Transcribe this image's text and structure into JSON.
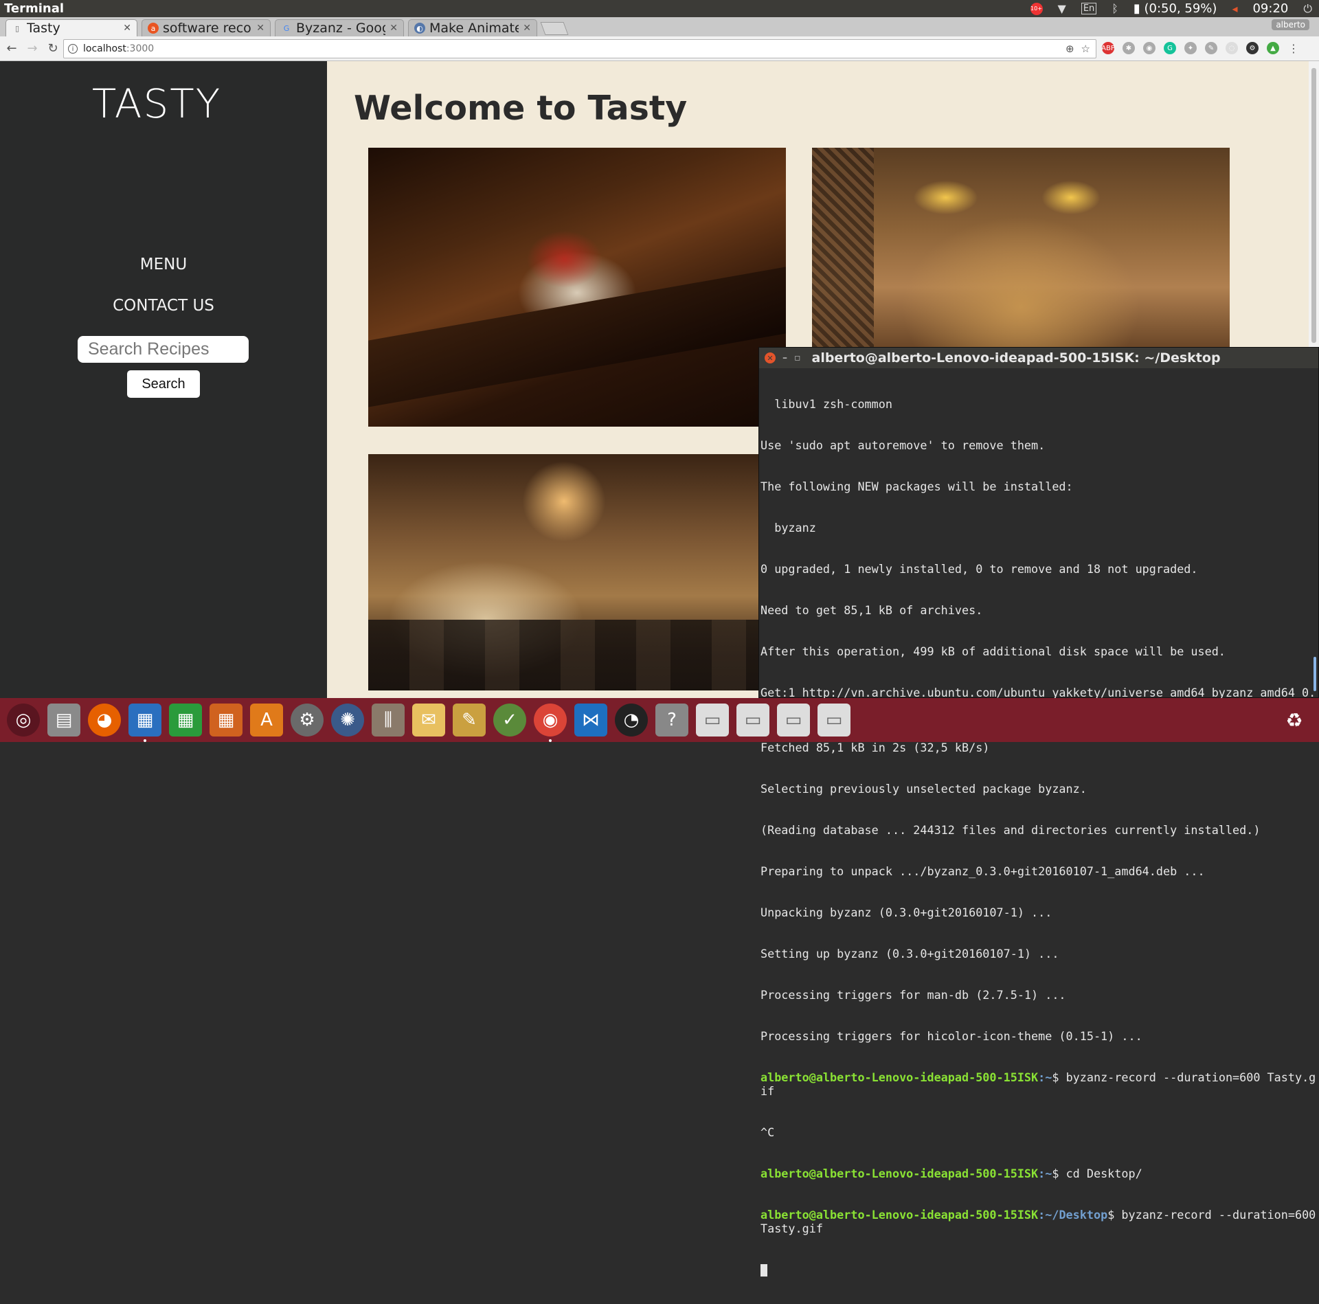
{
  "top_panel": {
    "title": "Terminal",
    "notification_badge": "10+",
    "battery": "(0:50, 59%)",
    "keyboard_layout": "En",
    "clock": "09:20"
  },
  "browser": {
    "tabs": [
      {
        "label": "Tasty",
        "active": true
      },
      {
        "label": "software reco",
        "active": false
      },
      {
        "label": "Byzanz - Goog",
        "active": false
      },
      {
        "label": "Make Animate",
        "active": false
      }
    ],
    "profile": "alberto",
    "url_host": "localhost",
    "url_port": ":3000"
  },
  "page": {
    "brand": "TASTY",
    "nav": {
      "menu": "MENU",
      "contact": "CONTACT US"
    },
    "search": {
      "placeholder": "Search Recipes",
      "button": "Search"
    },
    "title": "Welcome to Tasty"
  },
  "terminal": {
    "title": "alberto@alberto-Lenovo-ideapad-500-15ISK: ~/Desktop",
    "lines": [
      {
        "text": "  libuv1 zsh-common"
      },
      {
        "text": "Use 'sudo apt autoremove' to remove them."
      },
      {
        "text": "The following NEW packages will be installed:"
      },
      {
        "text": "  byzanz"
      },
      {
        "text": "0 upgraded, 1 newly installed, 0 to remove and 18 not upgraded."
      },
      {
        "text": "Need to get 85,1 kB of archives."
      },
      {
        "text": "After this operation, 499 kB of additional disk space will be used."
      },
      {
        "text": "Get:1 http://vn.archive.ubuntu.com/ubuntu yakkety/universe amd64 byzanz amd64 0.3.0+git20160107-1 [85,1 kB]"
      },
      {
        "text": "Fetched 85,1 kB in 2s (32,5 kB/s)"
      },
      {
        "text": "Selecting previously unselected package byzanz."
      },
      {
        "text": "(Reading database ... 244312 files and directories currently installed.)"
      },
      {
        "text": "Preparing to unpack .../byzanz_0.3.0+git20160107-1_amd64.deb ..."
      },
      {
        "text": "Unpacking byzanz (0.3.0+git20160107-1) ..."
      },
      {
        "text": "Setting up byzanz (0.3.0+git20160107-1) ..."
      },
      {
        "text": "Processing triggers for man-db (2.7.5-1) ..."
      },
      {
        "text": "Processing triggers for hicolor-icon-theme (0.15-1) ..."
      }
    ],
    "prompt1": {
      "user": "alberto@alberto-Lenovo-ideapad-500-15ISK",
      "path": ":~",
      "cmd": "$ byzanz-record --duration=600 Tasty.gif"
    },
    "interrupt": "^C",
    "prompt2": {
      "user": "alberto@alberto-Lenovo-ideapad-500-15ISK",
      "path": ":~",
      "cmd": "$ cd Desktop/"
    },
    "prompt3": {
      "user": "alberto@alberto-Lenovo-ideapad-500-15ISK",
      "path": ":~/Desktop",
      "cmd": "$ byzanz-record --duration=600 Tasty.gif"
    }
  },
  "launcher": {
    "items": [
      "ubuntu-icon",
      "files-icon",
      "firefox-icon",
      "writer-icon",
      "calc-icon",
      "impress-icon",
      "software-center-icon",
      "settings-icon",
      "shutter-icon",
      "mixer-icon",
      "mail-icon",
      "cleaner-icon",
      "clock-icon",
      "chrome-icon",
      "vscode-icon",
      "time-icon",
      "help-icon",
      "drive-icon",
      "drive-icon",
      "drive-icon",
      "drive-icon"
    ],
    "trash": "trash-icon"
  },
  "colors": {
    "sidebar": "#292a2a",
    "page_bg": "#f2ead9",
    "terminal_bg": "#2c2c2c",
    "prompt_user": "#8ae234",
    "prompt_path": "#729fcf",
    "launcher": "#7a1e2a"
  }
}
